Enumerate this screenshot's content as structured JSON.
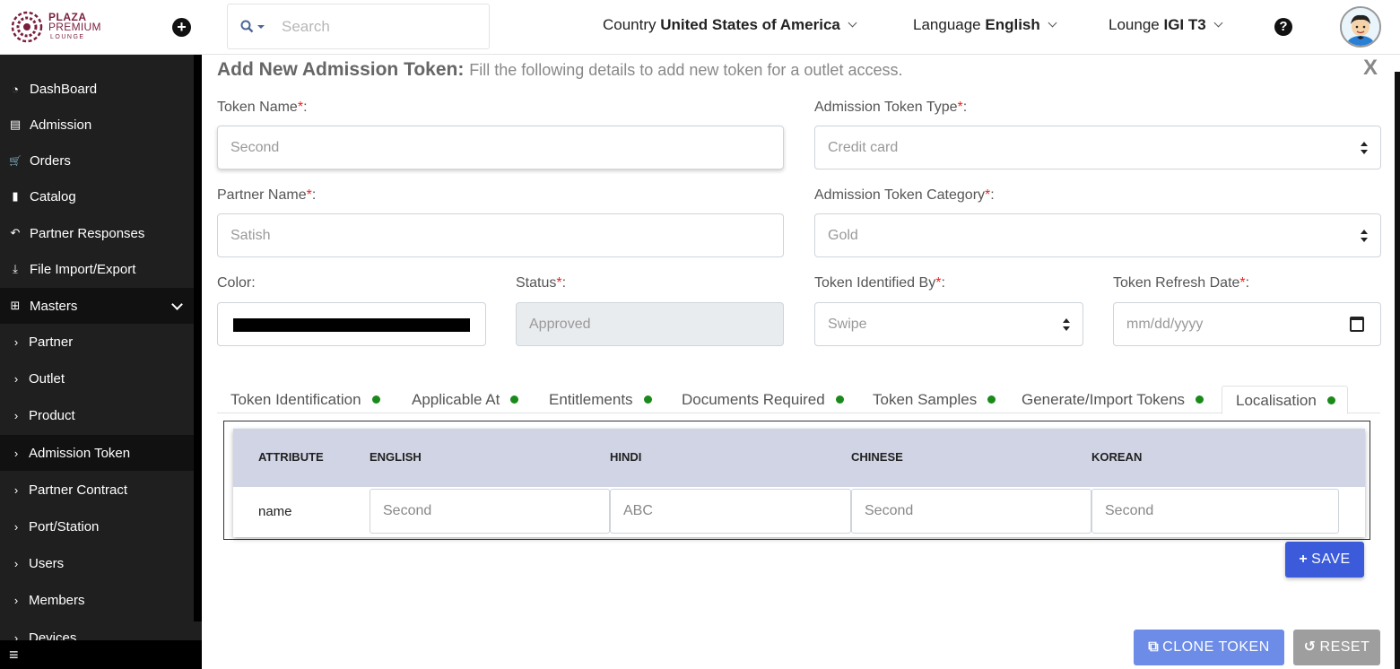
{
  "brand": {
    "line1": "PLAZA",
    "line2": "PREMIUM",
    "line3": "LOUNGE",
    "color": "#7a1f3b"
  },
  "header": {
    "search_placeholder": "Search",
    "country_label": "Country",
    "country_value": "United States of America",
    "language_label": "Language",
    "language_value": "English",
    "lounge_label": "Lounge",
    "lounge_value": "IGI T3",
    "help_icon": "?"
  },
  "sidebar": {
    "items": [
      {
        "icon": "dashboard-icon",
        "glyph": "◔",
        "label": "DashBoard"
      },
      {
        "icon": "id-card-icon",
        "glyph": "▤",
        "label": "Admission"
      },
      {
        "icon": "cart-icon",
        "glyph": "🛒",
        "label": "Orders"
      },
      {
        "icon": "file-icon",
        "glyph": "▮",
        "label": "Catalog"
      },
      {
        "icon": "reply-all-icon",
        "glyph": "↶",
        "label": "Partner Responses"
      },
      {
        "icon": "download-icon",
        "glyph": "⤓",
        "label": "File Import/Export"
      },
      {
        "icon": "sitemap-icon",
        "glyph": "⊞",
        "label": "Masters"
      }
    ],
    "sub_items": [
      {
        "label": "Partner"
      },
      {
        "label": "Outlet"
      },
      {
        "label": "Product"
      },
      {
        "label": "Admission Token"
      },
      {
        "label": "Partner Contract"
      },
      {
        "label": "Port/Station"
      },
      {
        "label": "Users"
      },
      {
        "label": "Members"
      },
      {
        "label": "Devices"
      }
    ],
    "menu_icon": "≡"
  },
  "form": {
    "title": "Add New Admission Token:",
    "subtitle": "Fill the following details to add new token for a outlet access.",
    "close": "X",
    "token_name_label": "Token Name",
    "token_name_value": "Second",
    "token_type_label": "Admission Token Type",
    "token_type_value": "Credit card",
    "partner_name_label": "Partner Name",
    "partner_name_value": "Satish",
    "token_category_label": "Admission Token Category",
    "token_category_value": "Gold",
    "color_label": "Color:",
    "color_value": "#000000",
    "status_label": "Status",
    "status_value": "Approved",
    "identified_by_label": "Token Identified By",
    "identified_by_value": "Swipe",
    "refresh_date_label": "Token Refresh Date",
    "refresh_date_placeholder": "mm/dd/yyyy",
    "required_mark": "*",
    "colon": ":"
  },
  "tabs": [
    {
      "label": "Token Identification"
    },
    {
      "label": "Applicable At"
    },
    {
      "label": "Entitlements"
    },
    {
      "label": "Documents Required"
    },
    {
      "label": "Token Samples"
    },
    {
      "label": "Generate/Import Tokens"
    },
    {
      "label": "Localisation"
    }
  ],
  "localisation": {
    "headers": [
      "ATTRIBUTE",
      "ENGLISH",
      "HINDI",
      "CHINESE",
      "KOREAN"
    ],
    "row_attribute": "name",
    "values": [
      "Second",
      "ABC",
      "Second",
      "Second"
    ]
  },
  "buttons": {
    "save": "SAVE",
    "clone": "CLONE TOKEN",
    "reset": "RESET"
  }
}
